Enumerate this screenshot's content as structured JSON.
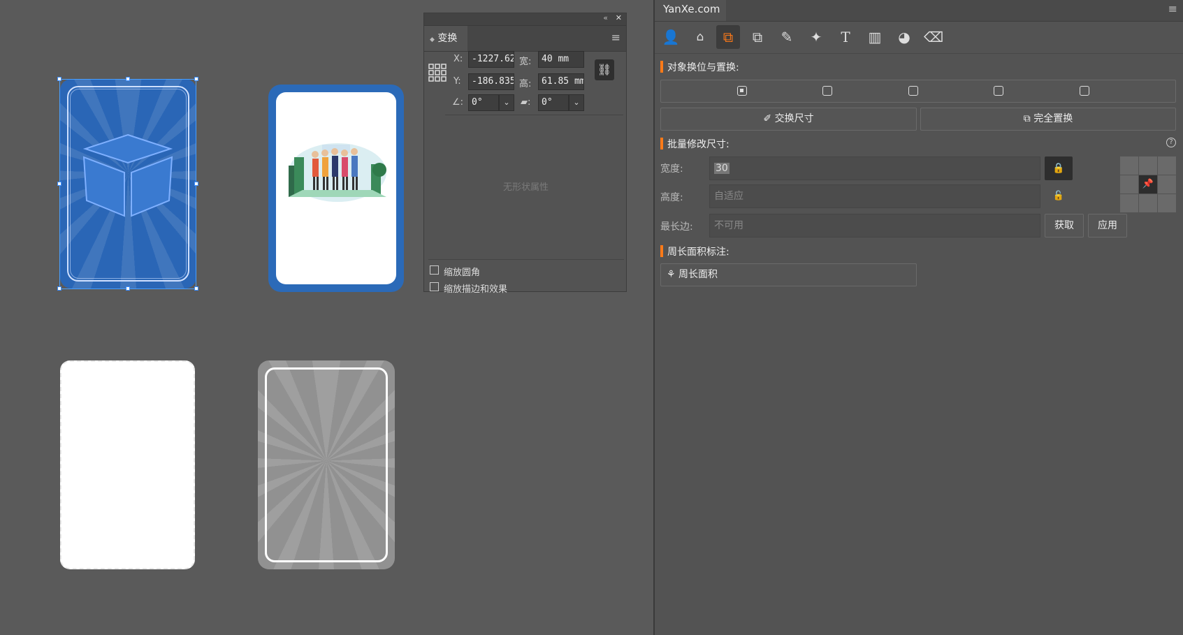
{
  "transform_panel": {
    "collapse_glyph": "«",
    "close_glyph": "✕",
    "tab_label": "变换",
    "x_label": "X:",
    "x_value": "-1227.62",
    "y_label": "Y:",
    "y_value": "-186.835",
    "width_label": "宽:",
    "width_value": "40 mm",
    "height_label": "高:",
    "height_value": "61.85 mm",
    "rotate_value": "0°",
    "shear_value": "0°",
    "no_shape_text": "无形状属性",
    "scale_corners_label": "缩放圆角",
    "scale_strokes_label": "缩放描边和效果"
  },
  "plugin_panel": {
    "title": "YanXe.com",
    "section_swap": "对象换位与置换:",
    "swap_size_button": "交换尺寸",
    "full_replace_button": "完全置换",
    "section_batch": "批量修改尺寸:",
    "width_label": "宽度:",
    "width_value": "30",
    "height_label": "高度:",
    "height_placeholder": "自适应",
    "longest_label": "最长边:",
    "longest_placeholder": "不可用",
    "get_button": "获取",
    "apply_button": "应用",
    "section_perimeter": "周长面积标注:",
    "perimeter_button": "周长面积"
  },
  "colors": {
    "accent": "#ff7a18",
    "card_blue": "#2a66b6"
  },
  "icons": {
    "tools": [
      "person-icon",
      "shapes-icon",
      "swap-objects-icon",
      "duplicate-icon",
      "pin-icon",
      "magic-wand-icon",
      "text-icon",
      "barcode-icon",
      "palette-icon",
      "eraser-icon"
    ],
    "help": "help-icon"
  }
}
